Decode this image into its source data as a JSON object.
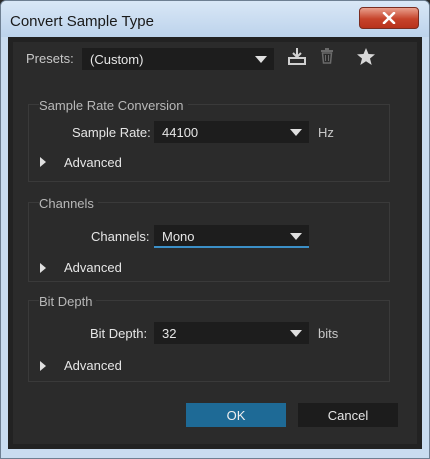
{
  "window": {
    "title": "Convert Sample Type"
  },
  "presets": {
    "label": "Presets:",
    "value": "(Custom)"
  },
  "sample_rate_group": {
    "title": "Sample Rate Conversion",
    "field_label": "Sample Rate:",
    "value": "44100",
    "unit": "Hz",
    "advanced_label": "Advanced"
  },
  "channels_group": {
    "title": "Channels",
    "field_label": "Channels:",
    "value": "Mono",
    "advanced_label": "Advanced"
  },
  "bit_depth_group": {
    "title": "Bit Depth",
    "field_label": "Bit Depth:",
    "value": "32",
    "unit": "bits",
    "advanced_label": "Advanced"
  },
  "buttons": {
    "ok": "OK",
    "cancel": "Cancel"
  },
  "colors": {
    "accent": "#3b8fc7",
    "ok_button": "#1e6a96",
    "close_button": "#c6432b"
  },
  "icons": {
    "save_preset": "download-icon",
    "delete_preset": "trash-icon",
    "favorite": "star-icon",
    "close": "close-icon"
  }
}
